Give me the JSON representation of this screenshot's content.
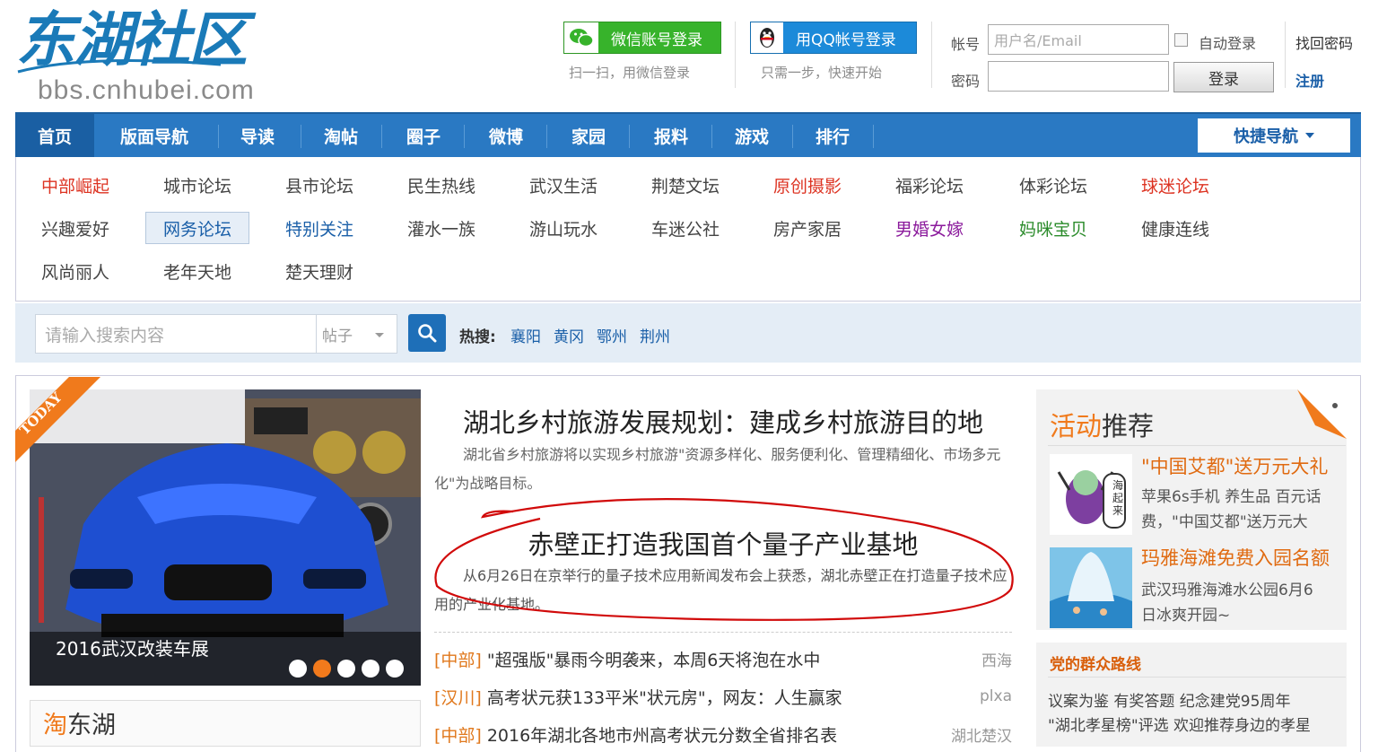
{
  "header": {
    "logo_cn": "东湖社区",
    "logo_url": "bbs.cnhubei.com",
    "wechat_login": "微信账号登录",
    "wechat_hint": "扫一扫，用微信登录",
    "qq_login": "用QQ帐号登录",
    "qq_hint": "只需一步，快速开始",
    "account_label": "帐号",
    "account_placeholder": "用户名/Email",
    "password_label": "密码",
    "auto_login": "自动登录",
    "login_button": "登录",
    "find_password": "找回密码",
    "register": "注册"
  },
  "nav": {
    "items": [
      "首页",
      "版面导航",
      "导读",
      "淘帖",
      "圈子",
      "微博",
      "家园",
      "报料",
      "游戏",
      "排行"
    ],
    "quick_nav": "快捷导航"
  },
  "forums": {
    "row1": [
      "中部崛起",
      "城市论坛",
      "县市论坛",
      "民生热线",
      "武汉生活",
      "荆楚文坛",
      "原创摄影",
      "福彩论坛",
      "体彩论坛",
      "球迷论坛"
    ],
    "row2": [
      "兴趣爱好",
      "网务论坛",
      "特别关注",
      "灌水一族",
      "游山玩水",
      "车迷公社",
      "房产家居",
      "男婚女嫁",
      "妈咪宝贝",
      "健康连线"
    ],
    "row3": [
      "风尚丽人",
      "老年天地",
      "楚天理财"
    ]
  },
  "search": {
    "placeholder": "请输入搜索内容",
    "type": "帖子",
    "hot_label": "热搜:",
    "hot_keywords": [
      "襄阳",
      "黄冈",
      "鄂州",
      "荆州"
    ]
  },
  "slideshow": {
    "badge": "TODAY",
    "caption": "2016武汉改装车展"
  },
  "headlines": [
    {
      "title": "湖北乡村旅游发展规划：建成乡村旅游目的地",
      "summary": "湖北省乡村旅游将以实现乡村旅游\"资源多样化、服务便利化、管理精细化、市场多元化\"为战略目标。"
    },
    {
      "title": "赤壁正打造我国首个量子产业基地",
      "summary": "从6月26日在京举行的量子技术应用新闻发布会上获悉，湖北赤壁正在打造量子技术应用的产业化基地。"
    }
  ],
  "news": [
    {
      "cat": "[中部]",
      "title": "\"超强版\"暴雨今明袭来，本周6天将泡在水中",
      "author": "西海"
    },
    {
      "cat": "[汉川]",
      "title": "高考状元获133平米\"状元房\"，网友：人生赢家",
      "author": "plxa"
    },
    {
      "cat": "[中部]",
      "title": "2016年湖北各地市州高考状元分数全省排名表",
      "author": "湖北楚汉"
    }
  ],
  "activities": {
    "title_orange": "活动",
    "title_rest": "推荐",
    "items": [
      {
        "title": "\"中国艾都\"送万元大礼",
        "desc1": "苹果6s手机 养生品 百元话",
        "desc2": "费，\"中国艾都\"送万元大",
        "img_text": "海起来"
      },
      {
        "title": "玛雅海滩免费入园名额",
        "desc1": "武汉玛雅海滩水公园6月6",
        "desc2": "日冰爽开园~"
      }
    ]
  },
  "party": {
    "title": "党的群众路线",
    "line1": "议案为鉴 有奖答题 纪念建党95周年",
    "line2": "\"湖北孝星榜\"评选 欢迎推荐身边的孝星"
  },
  "tao": {
    "orange": "淘",
    "rest": "东湖"
  }
}
